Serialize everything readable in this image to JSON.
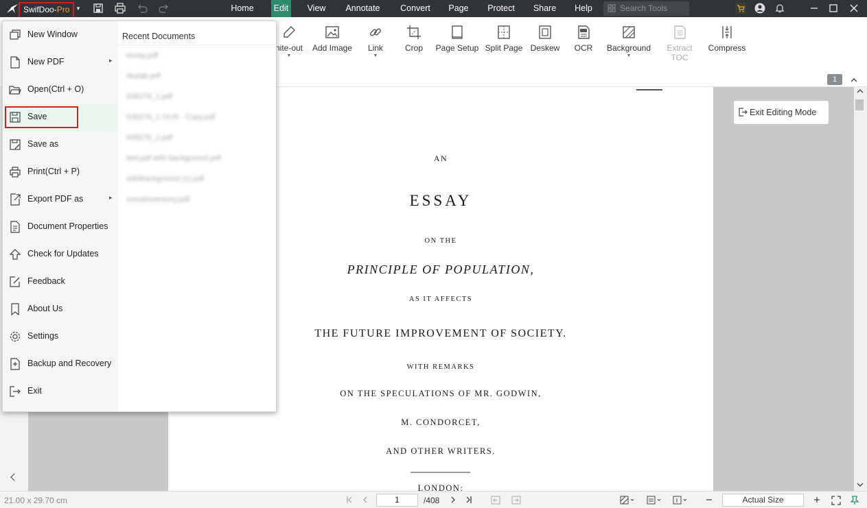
{
  "app": {
    "name_main": "SwifDoo-",
    "name_pro": "Pro"
  },
  "menu": [
    {
      "label": "Home"
    },
    {
      "label": "Edit"
    },
    {
      "label": "View"
    },
    {
      "label": "Annotate"
    },
    {
      "label": "Convert"
    },
    {
      "label": "Page"
    },
    {
      "label": "Protect"
    },
    {
      "label": "Share"
    },
    {
      "label": "Help"
    }
  ],
  "active_menu": "Edit",
  "search": {
    "placeholder": "Search Tools"
  },
  "ribbon": [
    {
      "label": "hite-out",
      "icon": "white-out-icon"
    },
    {
      "label": "Add Image",
      "icon": "image-icon"
    },
    {
      "label": "Link",
      "icon": "link-icon"
    },
    {
      "label": "Crop",
      "icon": "crop-icon"
    },
    {
      "label": "Page Setup",
      "icon": "page-setup-icon"
    },
    {
      "label": "Split Page",
      "icon": "split-page-icon"
    },
    {
      "label": "Deskew",
      "icon": "deskew-icon"
    },
    {
      "label": "OCR",
      "icon": "ocr-icon"
    },
    {
      "label": "Background",
      "icon": "background-icon"
    },
    {
      "label": "Extract TOC",
      "icon": "extract-toc-icon",
      "disabled": true
    },
    {
      "label": "Compress",
      "icon": "compress-icon"
    }
  ],
  "page_badge": "1",
  "exit_editing": "Exit Editing Mode",
  "file_menu": {
    "items": [
      {
        "label": "New Window",
        "icon": "new-window-icon"
      },
      {
        "label": "New PDF",
        "icon": "new-pdf-icon",
        "submenu": true
      },
      {
        "label": "Open(Ctrl + O)",
        "icon": "open-folder-icon"
      },
      {
        "label": "Save",
        "icon": "save-icon",
        "highlighted": true
      },
      {
        "label": "Save as",
        "icon": "save-as-icon"
      },
      {
        "label": "Print(Ctrl + P)",
        "icon": "print-icon"
      },
      {
        "label": "Export PDF as",
        "icon": "export-icon",
        "submenu": true
      },
      {
        "label": "Document Properties",
        "icon": "document-properties-icon"
      },
      {
        "label": "Check for Updates",
        "icon": "update-icon"
      },
      {
        "label": "Feedback",
        "icon": "feedback-icon"
      },
      {
        "label": "About Us",
        "icon": "bookmark-icon"
      },
      {
        "label": "Settings",
        "icon": "gear-icon"
      },
      {
        "label": "Backup and Recovery",
        "icon": "backup-icon"
      },
      {
        "label": "Exit",
        "icon": "exit-icon"
      }
    ],
    "recent_title": "Recent Documents",
    "recent_docs": [
      "essay.pdf",
      "skylab.pdf",
      "938276_1.pdf",
      "938276_1 OCR - Copy.pdf",
      "938276_2.pdf",
      "test.pdf with background.pdf",
      "withBackground (1).pdf",
      "somatosensory.pdf"
    ]
  },
  "document": {
    "lines": [
      "AN",
      "ESSAY",
      "ON THE",
      "PRINCIPLE OF POPULATION,",
      "AS IT AFFECTS",
      "THE FUTURE IMPROVEMENT OF SOCIETY.",
      "WITH REMARKS",
      "ON THE SPECULATIONS OF MR. GODWIN,",
      "M. CONDORCET,",
      "AND OTHER WRITERS.",
      "LONDON:"
    ]
  },
  "status": {
    "page_size": "21.00 x 29.70 cm",
    "current_page": "1",
    "total_pages": "/408",
    "zoom": "Actual Size"
  },
  "colors": {
    "titlebar": "#2f3437",
    "accent": "#2e8b6d",
    "highlight_border": "#d21f1f"
  }
}
